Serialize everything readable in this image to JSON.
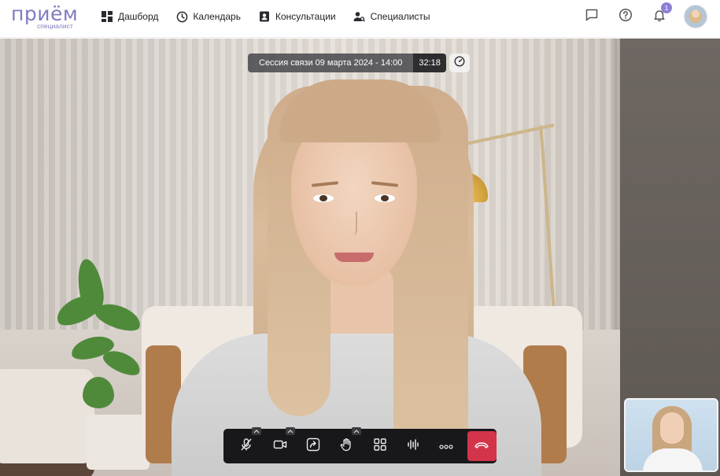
{
  "brand": {
    "name": "приём",
    "subtitle": "специалист"
  },
  "nav": {
    "items": [
      {
        "label": "Дашборд",
        "icon": "dashboard-icon"
      },
      {
        "label": "Календарь",
        "icon": "clock-icon"
      },
      {
        "label": "Консультации",
        "icon": "contact-card-icon"
      },
      {
        "label": "Специалисты",
        "icon": "users-icon"
      }
    ]
  },
  "header_actions": {
    "chat_icon": "chat-icon",
    "help_icon": "help-icon",
    "notifications_icon": "bell-icon",
    "notifications_count": "1",
    "avatar": "user-avatar"
  },
  "session": {
    "title": "Сессия связи 09 марта 2024 - 14:00",
    "timer": "32:18",
    "speed_icon": "speedometer-icon"
  },
  "controls": {
    "items": [
      {
        "name": "mic-muted",
        "icon": "mic-off-icon",
        "has_menu": true
      },
      {
        "name": "camera",
        "icon": "camera-icon",
        "has_menu": true
      },
      {
        "name": "share-screen",
        "icon": "share-screen-icon",
        "has_menu": false
      },
      {
        "name": "raise-hand",
        "icon": "hand-icon",
        "has_menu": true
      },
      {
        "name": "layout",
        "icon": "grid-icon",
        "has_menu": false
      },
      {
        "name": "audio-levels",
        "icon": "waveform-icon",
        "has_menu": false
      },
      {
        "name": "more",
        "icon": "more-icon",
        "has_menu": false
      }
    ],
    "hangup_icon": "hangup-icon"
  },
  "colors": {
    "brand": "#7f7cc0",
    "badge": "#8d7fd6",
    "control_bar": "#18181b",
    "hangup": "#d3344a"
  }
}
